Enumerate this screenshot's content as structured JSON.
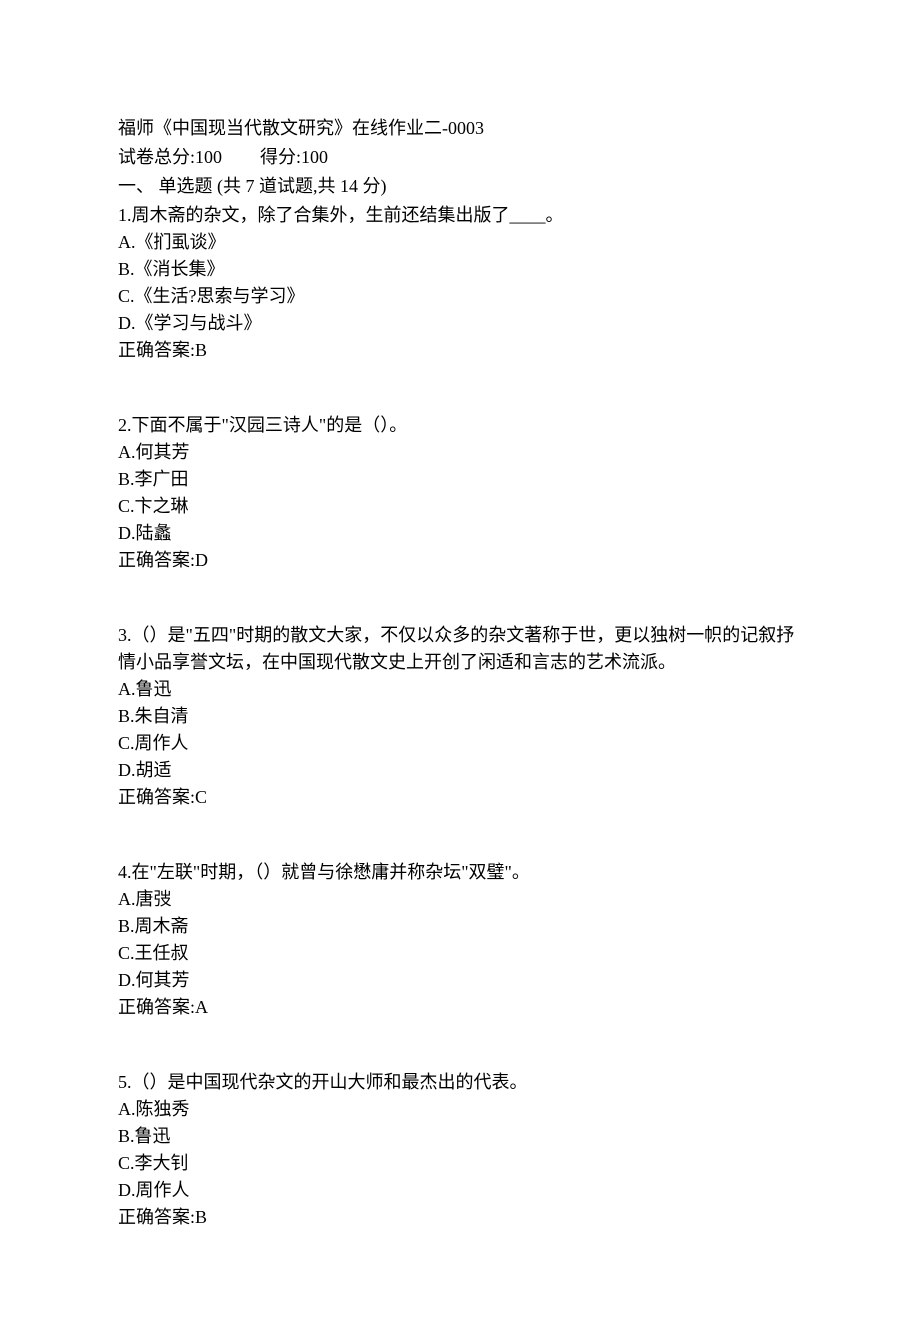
{
  "header": {
    "title": "福师《中国现当代散文研究》在线作业二-0003",
    "score_label_total": "试卷总分:100",
    "score_label_obtained": "得分:100",
    "section_title": "一、 单选题 (共 7 道试题,共 14 分)"
  },
  "questions": [
    {
      "text": "1.周木斋的杂文，除了合集外，生前还结集出版了____。",
      "opts": [
        "A.《扪虱谈》",
        "B.《消长集》",
        "C.《生活?思索与学习》",
        "D.《学习与战斗》"
      ],
      "answer": "正确答案:B"
    },
    {
      "text": "2.下面不属于\"汉园三诗人\"的是（）。",
      "opts": [
        "A.何其芳",
        "B.李广田",
        "C.卞之琳",
        "D.陆蠡"
      ],
      "answer": "正确答案:D"
    },
    {
      "text": "3.（）是\"五四\"时期的散文大家，不仅以众多的杂文著称于世，更以独树一帜的记叙抒情小品享誉文坛，在中国现代散文史上开创了闲适和言志的艺术流派。",
      "opts": [
        "A.鲁迅",
        "B.朱自清",
        "C.周作人",
        "D.胡适"
      ],
      "answer": "正确答案:C"
    },
    {
      "text": "4.在\"左联\"时期，（）就曾与徐懋庸并称杂坛\"双璧\"。",
      "opts": [
        "A.唐弢",
        "B.周木斋",
        "C.王任叔",
        "D.何其芳"
      ],
      "answer": "正确答案:A"
    },
    {
      "text": "5.（）是中国现代杂文的开山大师和最杰出的代表。",
      "opts": [
        "A.陈独秀",
        "B.鲁迅",
        "C.李大钊",
        "D.周作人"
      ],
      "answer": "正确答案:B"
    }
  ]
}
